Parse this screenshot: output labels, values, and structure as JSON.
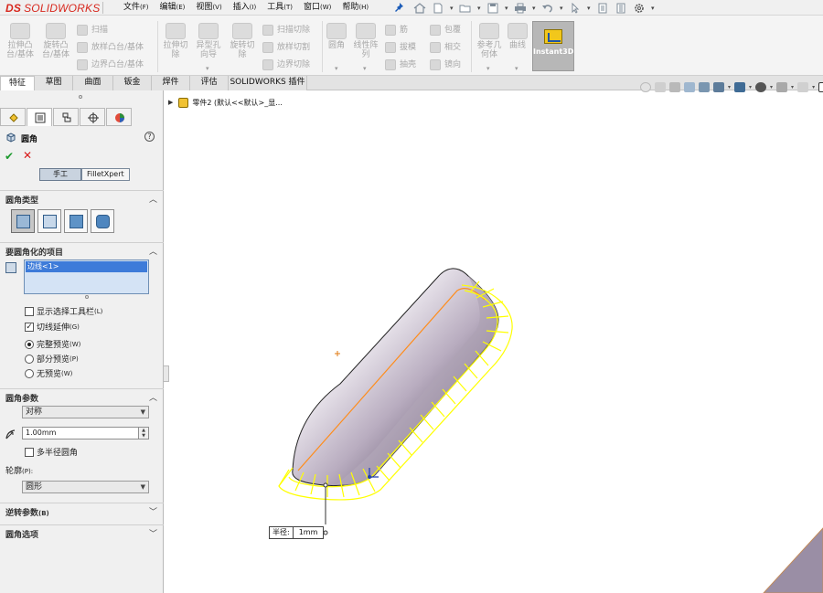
{
  "app": {
    "logo_ds": "DS",
    "logo_text": "SOLIDWORKS"
  },
  "menu": [
    {
      "label": "文件",
      "acc": "(F)"
    },
    {
      "label": "编辑",
      "acc": "(E)"
    },
    {
      "label": "视图",
      "acc": "(V)"
    },
    {
      "label": "插入",
      "acc": "(I)"
    },
    {
      "label": "工具",
      "acc": "(T)"
    },
    {
      "label": "窗口",
      "acc": "(W)"
    },
    {
      "label": "帮助",
      "acc": "(H)"
    }
  ],
  "ribbon": {
    "extrude_boss": "拉伸凸\n台/基体",
    "revolve_boss": "旋转凸\n台/基体",
    "sweep": "扫描",
    "loft_boss": "放样凸台/基体",
    "boundary_boss": "边界凸台/基体",
    "extrude_cut": "拉伸切\n除",
    "hole_wizard": "异型孔\n向导",
    "revolve_cut": "旋转切\n除",
    "sweep_cut": "扫描切除",
    "loft_cut": "放样切割",
    "boundary_cut": "边界切除",
    "fillet": "圆角",
    "linear_pattern": "线性阵\n列",
    "rib": "筋",
    "draft": "拔模",
    "shell": "抽壳",
    "wrap": "包覆",
    "intersect": "相交",
    "mirror": "镜向",
    "ref_geometry": "参考几\n何体",
    "curves": "曲线",
    "instant3d": "Instant3D"
  },
  "tabs": [
    {
      "label": "特征",
      "active": true
    },
    {
      "label": "草图",
      "active": false
    },
    {
      "label": "曲面",
      "active": false
    },
    {
      "label": "钣金",
      "active": false
    },
    {
      "label": "焊件",
      "active": false
    },
    {
      "label": "评估",
      "active": false
    },
    {
      "label": "SOLIDWORKS 插件",
      "active": false
    }
  ],
  "property_manager": {
    "title": "圆角",
    "help": "?",
    "ok": "✔",
    "cancel": "✕",
    "mode_manual": "手工",
    "mode_filletxpert": "FilletXpert",
    "section_fillet_type": "圆角类型",
    "section_items": "要圆角化的项目",
    "edge_item": "边线<1>",
    "show_selection_toolbar": "显示选择工具栏",
    "show_selection_toolbar_acc": "(L)",
    "tangent_propagation": "切线延伸",
    "tangent_propagation_acc": "(G)",
    "full_preview": "完整预览",
    "full_preview_acc": "(W)",
    "partial_preview": "部分预览",
    "partial_preview_acc": "(P)",
    "no_preview": "无预览",
    "no_preview_acc": "(W)",
    "section_params": "圆角参数",
    "method_value": "对称",
    "radius_value": "1.00mm",
    "multi_radius": "多半径圆角",
    "profile_label": "轮廓",
    "profile_label_acc": "(P):",
    "profile_value": "圆形",
    "section_setback": "逆转参数",
    "section_setback_acc": "(B)",
    "section_options": "圆角选项"
  },
  "feature_tree": {
    "part_label": "零件2  (默认<<默认>_显..."
  },
  "callout": {
    "label": "半径:",
    "value": "1mm"
  },
  "colors": {
    "logo_red": "#d7281e",
    "fillet_preview": "#ffff00",
    "accent_blue": "#3d7bd9",
    "selected_edge": "#ff8c1a"
  }
}
